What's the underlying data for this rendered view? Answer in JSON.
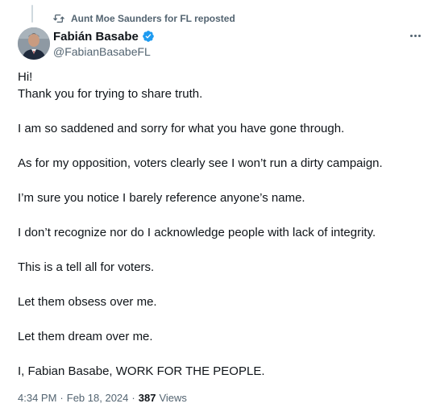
{
  "repost": {
    "label": "Aunt Moe Saunders for FL reposted"
  },
  "author": {
    "name": "Fabián Basabe",
    "handle": "@FabianBasabeFL"
  },
  "post": {
    "lines": [
      "Hi!",
      "Thank you for trying to share truth.",
      "I am so saddened and sorry for what you have gone through.",
      "As for my opposition, voters clearly see I won’t run a dirty campaign.",
      "I’m sure you notice I barely reference anyone’s name.",
      "I don’t recognize nor do I acknowledge people with lack of integrity.",
      "This is a tell all for voters.",
      "Let them obsess over me.",
      "Let them dream over me.",
      "I, Fabian Basabe, WORK FOR THE PEOPLE."
    ]
  },
  "meta": {
    "time": "4:34 PM",
    "date": "Feb 18, 2024",
    "separator": "·",
    "views_count": "387",
    "views_label": "Views"
  },
  "colors": {
    "text_primary": "#0f1419",
    "text_secondary": "#536471",
    "verified_blue": "#1d9bf0"
  },
  "icons": {
    "repost": "repost-icon",
    "verified": "verified-badge-icon",
    "more": "more-options-icon"
  }
}
